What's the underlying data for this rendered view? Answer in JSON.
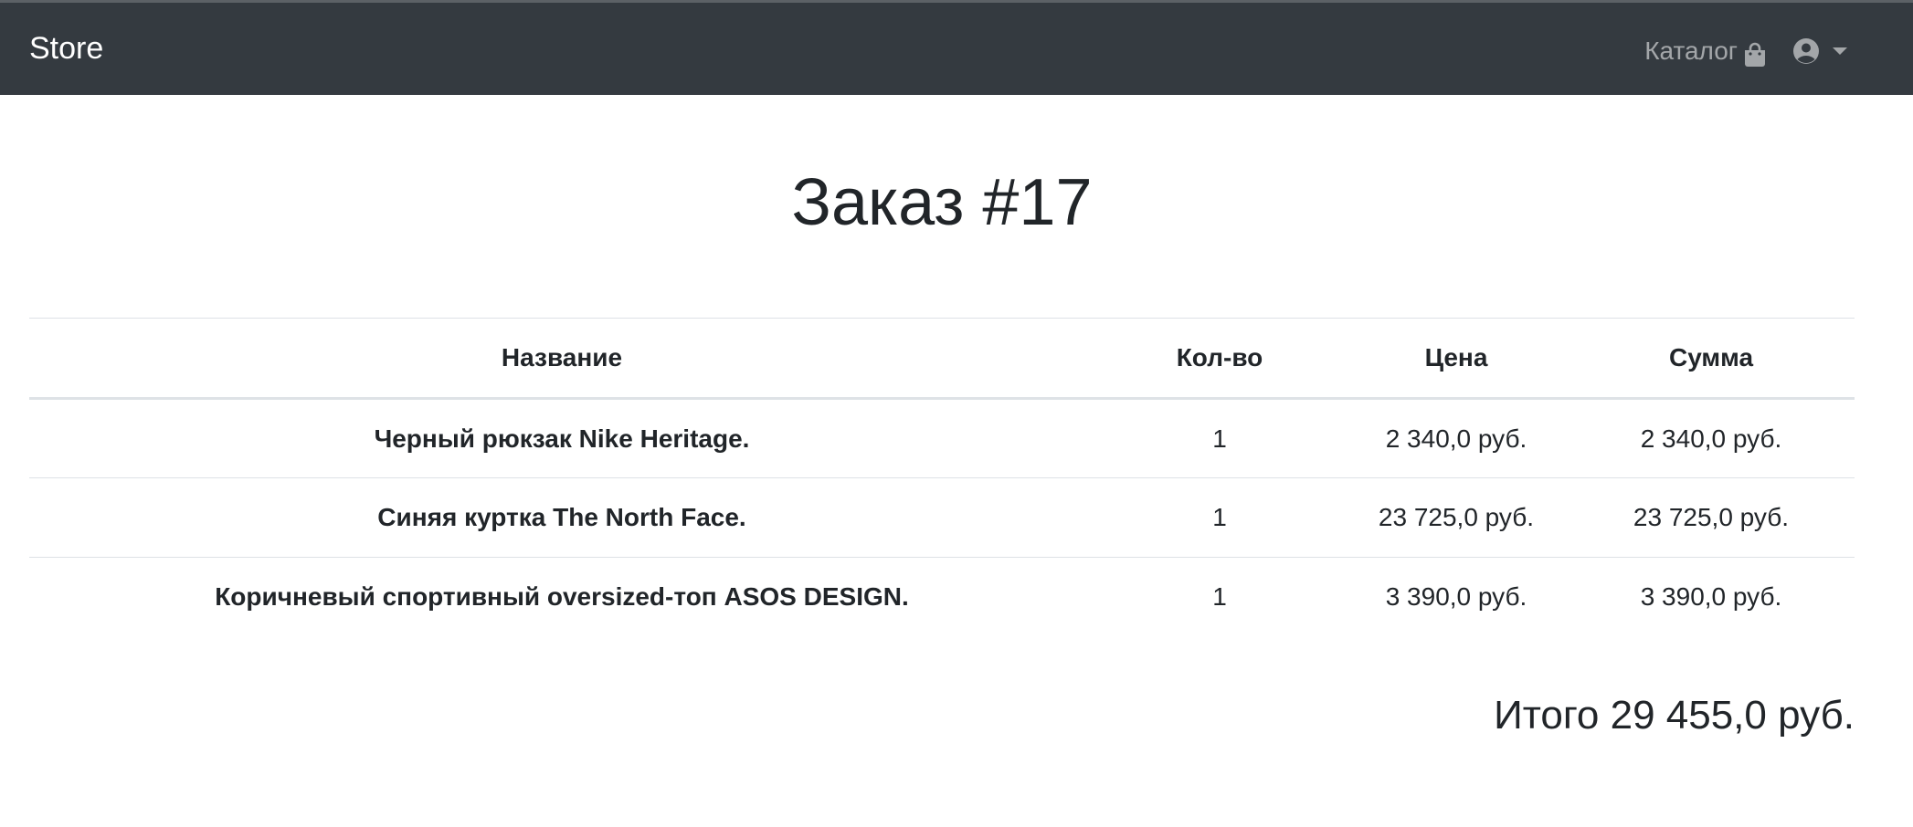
{
  "navbar": {
    "brand": "Store",
    "catalog_label": "Каталог",
    "icons": {
      "catalog": "shopping-bag-icon",
      "user": "user-circle-icon",
      "dropdown": "caret-down-icon"
    },
    "colors": {
      "background": "#343a40",
      "brand_text": "#ffffff",
      "link_text": "rgba(255,255,255,0.55)"
    }
  },
  "order": {
    "title": "Заказ #17",
    "table": {
      "headers": {
        "name": "Название",
        "qty": "Кол-во",
        "price": "Цена",
        "sum": "Сумма"
      },
      "rows": [
        {
          "name": "Черный рюкзак Nike Heritage.",
          "qty": "1",
          "price": "2 340,0 руб.",
          "sum": "2 340,0 руб."
        },
        {
          "name": "Синяя куртка The North Face.",
          "qty": "1",
          "price": "23 725,0 руб.",
          "sum": "23 725,0 руб."
        },
        {
          "name": "Коричневый спортивный oversized-топ ASOS DESIGN.",
          "qty": "1",
          "price": "3 390,0 руб.",
          "sum": "3 390,0 руб."
        }
      ]
    },
    "total": "Итого 29 455,0 руб."
  }
}
